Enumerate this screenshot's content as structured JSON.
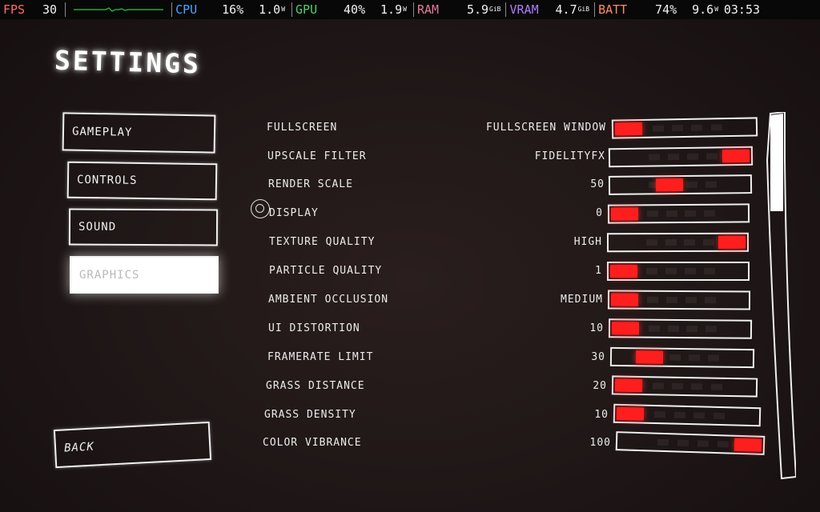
{
  "overlay": {
    "fps_label": "FPS",
    "fps_value": "30",
    "cpu_label": "CPU",
    "cpu_pct": "16%",
    "cpu_watts": "1.0",
    "cpu_unit": "W",
    "gpu_label": "GPU",
    "gpu_pct": "40%",
    "gpu_watts": "1.9",
    "gpu_unit": "W",
    "ram_label": "RAM",
    "ram_value": "5.9",
    "ram_unit": "GiB",
    "vram_label": "VRAM",
    "vram_value": "4.7",
    "vram_unit": "GiB",
    "batt_label": "BATT",
    "batt_pct": "74%",
    "batt_watts": "9.6",
    "batt_unit": "W",
    "clock": "03:53",
    "colors": {
      "fps": "#ff6b6b",
      "cpu": "#4aa3ff",
      "gpu": "#4fd06a",
      "ram": "#e07aa0",
      "vram": "#b07cff",
      "batt": "#ff8a6b",
      "graph": "#22cc44"
    }
  },
  "title": "SETTINGS",
  "menu": {
    "gameplay": "GAMEPLAY",
    "controls": "CONTROLS",
    "sound": "SOUND",
    "graphics": "GRAPHICS",
    "back": "BACK"
  },
  "settings": [
    {
      "label": "FULLSCREEN",
      "value": "FULLSCREEN WINDOW",
      "level": 0.0
    },
    {
      "label": "UPSCALE FILTER",
      "value": "FIDELITYFX",
      "level": 1.0
    },
    {
      "label": "RENDER SCALE",
      "value": "50",
      "level": 0.4
    },
    {
      "label": "DISPLAY",
      "value": "0",
      "level": 0.0
    },
    {
      "label": "TEXTURE QUALITY",
      "value": "HIGH",
      "level": 1.0
    },
    {
      "label": "PARTICLE QUALITY",
      "value": "1",
      "level": 0.0
    },
    {
      "label": "AMBIENT OCCLUSION",
      "value": "MEDIUM",
      "level": 0.0
    },
    {
      "label": "UI DISTORTION",
      "value": "10",
      "level": 0.0
    },
    {
      "label": "FRAMERATE LIMIT",
      "value": "30",
      "level": 0.2
    },
    {
      "label": "GRASS DISTANCE",
      "value": "20",
      "level": 0.0
    },
    {
      "label": "GRASS DENSITY",
      "value": "10",
      "level": 0.0
    },
    {
      "label": "COLOR VIBRANCE",
      "value": "100",
      "level": 1.0
    }
  ],
  "scroll": {
    "position": 0.0,
    "visible_fraction": 0.27
  }
}
